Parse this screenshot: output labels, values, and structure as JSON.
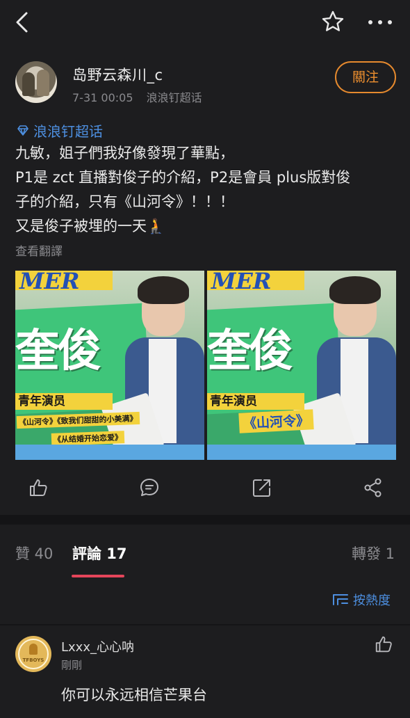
{
  "topbar": {
    "back_icon": "chevron-left-icon",
    "star_icon": "star-outline-icon",
    "more_icon": "more-horizontal-icon"
  },
  "post": {
    "username": "岛野云森川_c",
    "timestamp": "7-31 00:05",
    "source": "浪浪钉超话",
    "follow_label": "關注",
    "topic_link": "浪浪钉超话",
    "text_lines": [
      "九敏，姐子們我好像發現了華點，",
      "P1是 zct 直播對俊子的介紹，P2是會員 plus版對俊",
      "子的介紹，只有《山河令》！！！",
      "又是俊子被埋的一天🧎"
    ],
    "translate_label": "查看翻譯",
    "images": [
      {
        "top_text": "MER",
        "big_text": "奎俊",
        "ribbon": "青年演员",
        "sub_lines": [
          "《山河令》《致我们甜甜的小美满》",
          "《从结婚开始恋爱》"
        ]
      },
      {
        "top_text": "MER",
        "big_text": "奎俊",
        "ribbon": "青年演员",
        "sub_lines": [
          "《山河令》"
        ]
      }
    ]
  },
  "actions": {
    "like_icon": "thumbs-up-icon",
    "comment_icon": "comment-icon",
    "repost_icon": "share-external-icon",
    "share_icon": "share-nodes-icon"
  },
  "tabs": {
    "likes": "贊 40",
    "comments": "評論 17",
    "reposts": "轉發 1",
    "sort_label": "按熱度"
  },
  "comment": {
    "username": "Lxxx_心心呐",
    "time": "剛剛",
    "text": "你可以永远相信芒果台",
    "avatar_text": "TFBOYS"
  },
  "colors": {
    "background": "#1d1d1f",
    "accent_blue": "#4d8fe0",
    "follow_orange": "#e68a2e",
    "tab_underline": "#e5455a"
  }
}
